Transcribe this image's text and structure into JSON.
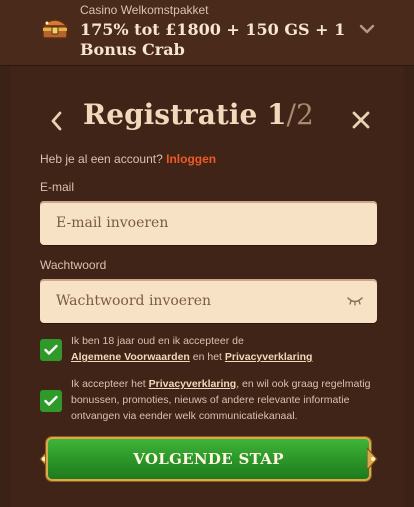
{
  "promo": {
    "caption": "Casino Welkomstpakket",
    "title": "175% tot £1800 + 150 GS + 1 Bonus Crab",
    "icon": "treasure-chest-icon"
  },
  "form": {
    "title_main": "Registratie 1",
    "title_step": "/2",
    "account_text": "Heb je al een account?",
    "login_link": "Inloggen",
    "email_label": "E-mail",
    "email_placeholder": "E-mail invoeren",
    "email_value": "",
    "password_label": "Wachtwoord",
    "password_placeholder": "Wachtwoord invoeren",
    "password_value": ""
  },
  "consents": {
    "age": {
      "checked": true,
      "text_a": "Ik ben 18 jaar oud en ik accepteer de",
      "link_a": "Algemene Voorwaarden",
      "text_b": "en het",
      "link_b": "Privacyverklaring"
    },
    "marketing": {
      "checked": true,
      "text_a": "Ik accepteer het",
      "link_a": "Privacyverklaring",
      "text_b": ", en wil ook graag regelmatig bonussen, promoties, nieuws of andere relevante informatie ontvangen via eender welk communicatiekanaal."
    }
  },
  "button": {
    "label": "VOLGENDE STAP"
  },
  "colors": {
    "background": "#3b2216",
    "accent_link": "#f05a24",
    "checkbox": "#2f9a2a",
    "button": "#2e9a2a",
    "button_border": "#d9a94a"
  }
}
